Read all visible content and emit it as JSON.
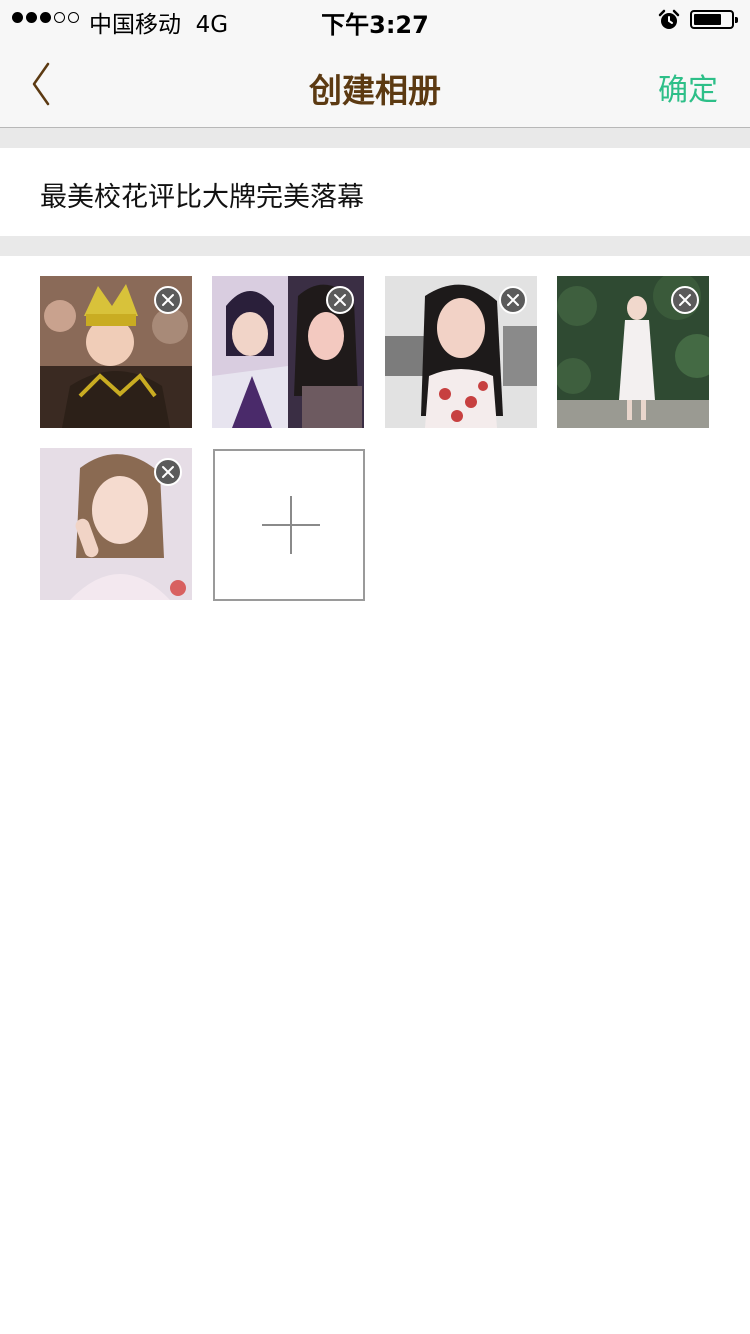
{
  "status_bar": {
    "carrier": "中国移动",
    "network": "4G",
    "time": "下午3:27",
    "battery_level": 0.75,
    "signal_bars_filled": 3,
    "signal_bars_total": 5
  },
  "nav": {
    "back_icon": "chevron-left-icon",
    "title": "创建相册",
    "confirm_label": "确定"
  },
  "album": {
    "name": "最美校花评比大牌完美落幕"
  },
  "photos": [
    {
      "description_icon": "photo-icon"
    },
    {
      "description_icon": "photo-icon"
    },
    {
      "description_icon": "photo-icon"
    },
    {
      "description_icon": "photo-icon"
    },
    {
      "description_icon": "photo-icon"
    }
  ],
  "colors": {
    "title": "#5c3a12",
    "confirm": "#2dbf88",
    "divider": "#e9e9e9",
    "bar_bg": "#f7f7f7"
  }
}
